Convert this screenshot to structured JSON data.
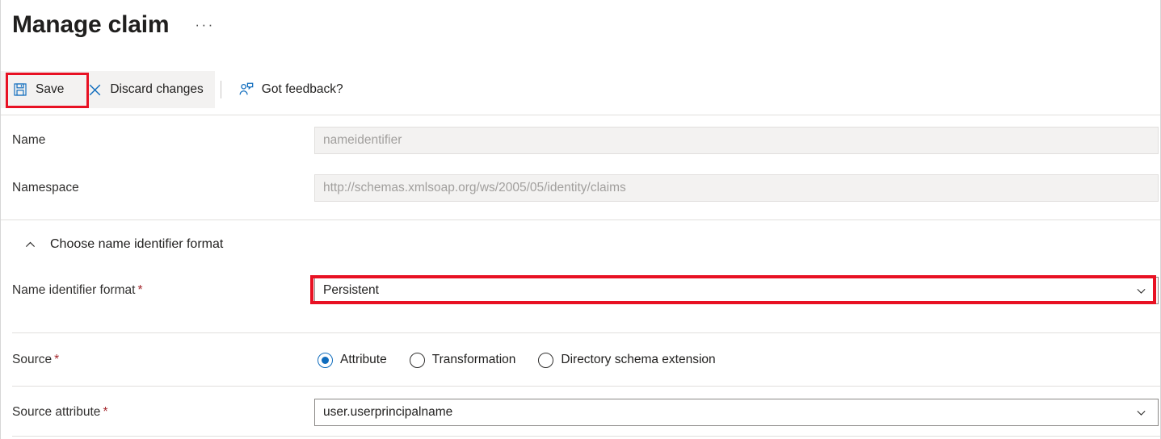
{
  "header": {
    "title": "Manage claim",
    "ellipsis": "···"
  },
  "toolbar": {
    "save_label": "Save",
    "discard_label": "Discard changes",
    "feedback_label": "Got feedback?",
    "save_icon": "save-floppy-icon",
    "discard_icon": "close-x-icon",
    "feedback_icon": "person-feedback-icon"
  },
  "fields": {
    "name": {
      "label": "Name",
      "value": "nameidentifier",
      "readonly": true
    },
    "namespace": {
      "label": "Namespace",
      "value": "http://schemas.xmlsoap.org/ws/2005/05/identity/claims",
      "readonly": true
    },
    "name_identifier_format": {
      "label": "Name identifier format",
      "required": "*",
      "value": "Persistent"
    },
    "source_attribute": {
      "label": "Source attribute",
      "required": "*",
      "value": "user.userprincipalname"
    }
  },
  "section": {
    "name_identifier": {
      "title": "Choose name identifier format",
      "expanded": true,
      "caret_icon": "chevron-up-icon"
    }
  },
  "source": {
    "label": "Source",
    "required": "*",
    "options": [
      {
        "label": "Attribute",
        "selected": true
      },
      {
        "label": "Transformation",
        "selected": false
      },
      {
        "label": "Directory schema extension",
        "selected": false
      }
    ]
  },
  "colors": {
    "accent": "#0f6cbd",
    "highlight": "#e81123",
    "required": "#a4262c",
    "toolbar_bg": "#f3f2f1",
    "readonly_bg": "#f3f2f1",
    "divider": "#e1dfdd"
  }
}
